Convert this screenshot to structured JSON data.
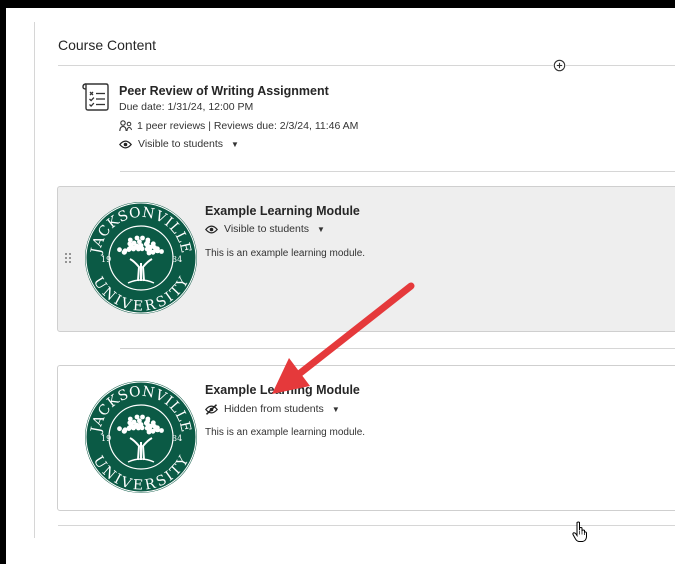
{
  "section": {
    "title": "Course Content"
  },
  "assignment": {
    "title": "Peer Review of Writing Assignment",
    "due": "Due date: 1/31/24, 12:00 PM",
    "reviews": "1 peer reviews | Reviews due: 2/3/24, 11:46 AM",
    "visibility": "Visible to students"
  },
  "modules": [
    {
      "title": "Example Learning Module",
      "visibility": "Visible to students",
      "description": "This is an example learning module."
    },
    {
      "title": "Example Learning Module",
      "visibility": "Hidden from students",
      "description": "This is an example learning module."
    }
  ],
  "logo": {
    "text_top": "JACKSONVILLE",
    "text_bottom": "UNIVERSITY",
    "year_left": "19",
    "year_right": "34"
  },
  "colors": {
    "logo_green": "#0b5a45",
    "arrow_red": "#e5393b",
    "card_shaded": "#eeeeee"
  },
  "icons": [
    "add-icon",
    "assignment-icon",
    "peer-review-icon",
    "eye-icon",
    "eye-slash-icon",
    "drag-handle-icon",
    "hand-cursor-icon"
  ]
}
